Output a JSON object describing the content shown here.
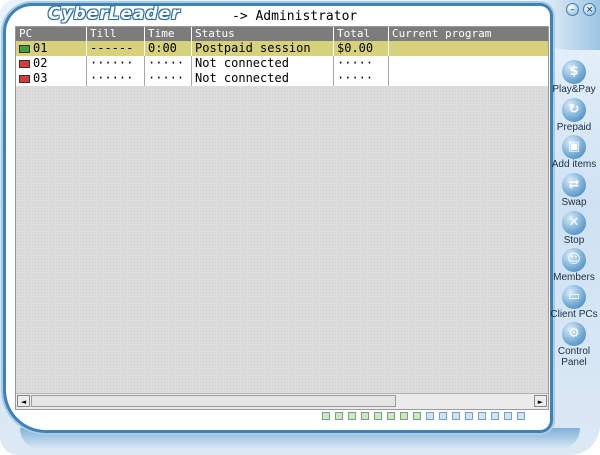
{
  "app": {
    "logo_text": "CyberLeader",
    "user_label": "-> Administrator"
  },
  "colors": {
    "selected_row": "#d7d17b",
    "header_bg": "#7c7c7c",
    "skin_blue": "#3f82b6"
  },
  "grid": {
    "columns": [
      "PC",
      "Till",
      "Time",
      "Status",
      "Total",
      "Current program"
    ],
    "rows": [
      {
        "pc": "01",
        "flag": "green",
        "till": "------",
        "time": "0:00",
        "status": "Postpaid session",
        "total": "$0.00",
        "program": "",
        "selected": true
      },
      {
        "pc": "02",
        "flag": "red",
        "till": "······",
        "time": "·····",
        "status": "Not connected",
        "total": "·····",
        "program": "",
        "selected": false
      },
      {
        "pc": "03",
        "flag": "red",
        "till": "······",
        "time": "·····",
        "status": "Not connected",
        "total": "·····",
        "program": "",
        "selected": false
      }
    ]
  },
  "scrollbar": {
    "left_arrow": "◄",
    "right_arrow": "►"
  },
  "status_squares": [
    "green",
    "green",
    "green",
    "green",
    "green",
    "green",
    "green",
    "green",
    "blue",
    "blue",
    "blue",
    "blue",
    "blue",
    "blue",
    "blue",
    "blue"
  ],
  "toolbar": {
    "items": [
      {
        "label": "Play&Pay",
        "icon": "dollar-icon",
        "glyph": "$"
      },
      {
        "label": "Prepaid",
        "icon": "prepaid-icon",
        "glyph": "↻"
      },
      {
        "label": "Add items",
        "icon": "add-items-icon",
        "glyph": "▣"
      },
      {
        "label": "Swap",
        "icon": "swap-icon",
        "glyph": "⇄"
      },
      {
        "label": "Stop",
        "icon": "stop-icon",
        "glyph": "✕"
      },
      {
        "label": "Members",
        "icon": "members-icon",
        "glyph": "☺"
      },
      {
        "label": "Client PCs",
        "icon": "client-pcs-icon",
        "glyph": "▭"
      },
      {
        "label": "Control Panel",
        "icon": "control-panel-icon",
        "glyph": "⚙"
      }
    ]
  }
}
